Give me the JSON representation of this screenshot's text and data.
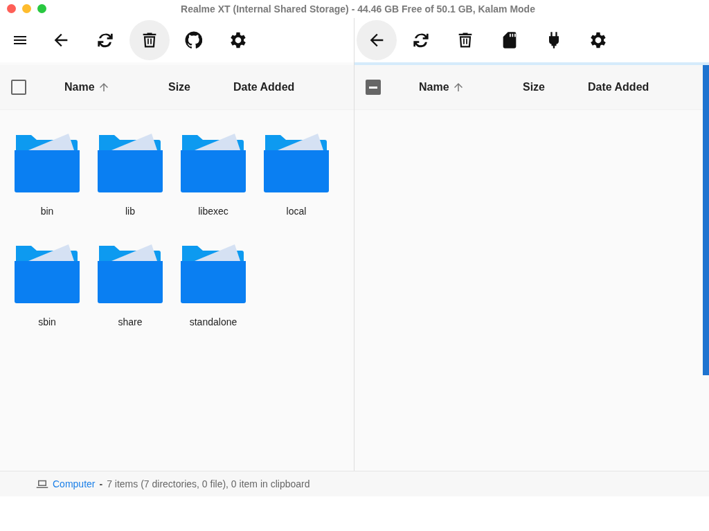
{
  "window": {
    "title": "Realme XT (Internal Shared Storage) - 44.46 GB Free of 50.1 GB, Kalam Mode"
  },
  "panes": [
    {
      "active": false,
      "toolbar": [
        {
          "kind": "menu",
          "highlighted": false
        },
        {
          "kind": "back",
          "highlighted": false
        },
        {
          "kind": "refresh",
          "highlighted": false
        },
        {
          "kind": "trash",
          "highlighted": true
        },
        {
          "kind": "github",
          "highlighted": false
        },
        {
          "kind": "settings",
          "highlighted": false
        }
      ],
      "header": {
        "checked": false,
        "columns": [
          {
            "label": "Name",
            "sorted": true
          },
          {
            "label": "Size",
            "sorted": false
          },
          {
            "label": "Date Added",
            "sorted": false
          }
        ]
      },
      "items": [
        {
          "name": "bin"
        },
        {
          "name": "lib"
        },
        {
          "name": "libexec"
        },
        {
          "name": "local"
        },
        {
          "name": "sbin"
        },
        {
          "name": "share"
        },
        {
          "name": "standalone"
        }
      ]
    },
    {
      "active": true,
      "toolbar": [
        {
          "kind": "back",
          "highlighted": true
        },
        {
          "kind": "refresh",
          "highlighted": false
        },
        {
          "kind": "trash",
          "highlighted": false
        },
        {
          "kind": "sdcard",
          "highlighted": false
        },
        {
          "kind": "plug",
          "highlighted": false
        },
        {
          "kind": "settings",
          "highlighted": false
        }
      ],
      "header": {
        "indeterminate": true,
        "columns": [
          {
            "label": "Name",
            "sorted": true
          },
          {
            "label": "Size",
            "sorted": false
          },
          {
            "label": "Date Added",
            "sorted": false
          }
        ]
      }
    }
  ],
  "status_bar": {
    "location": "Computer",
    "separator": "-",
    "summary": "7 items (7 directories, 0 file), 0 item in clipboard"
  }
}
